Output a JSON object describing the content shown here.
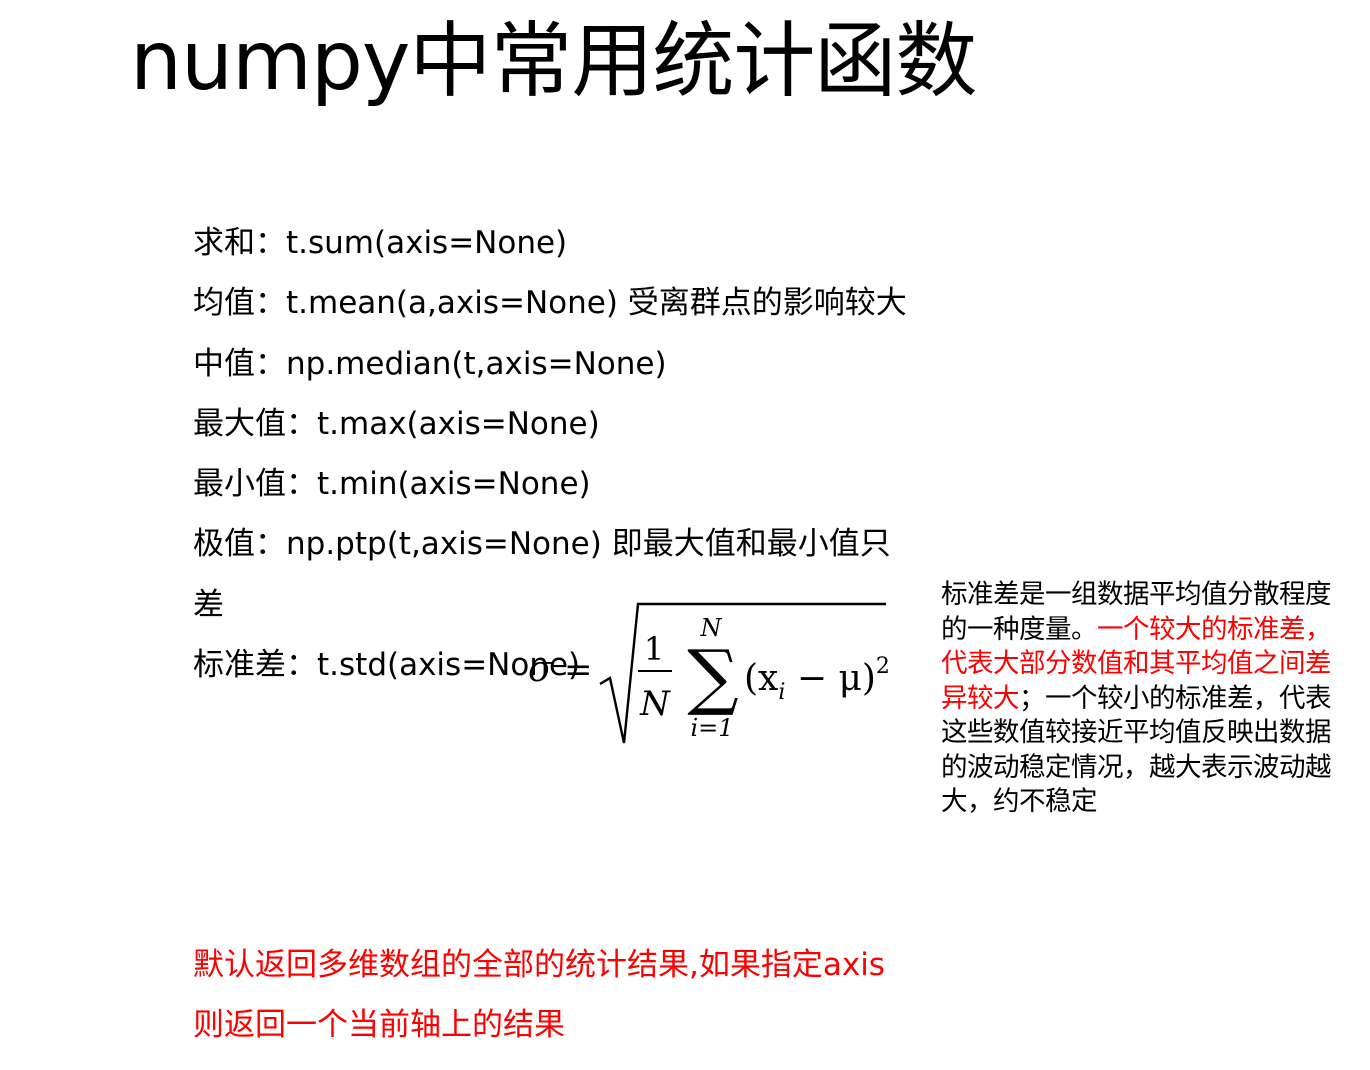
{
  "title": "numpy中常用统计函数",
  "functions": [
    {
      "text": "求和：t.sum(axis=None)"
    },
    {
      "text": "均值：t.mean(a,axis=None)  受离群点的影响较大"
    },
    {
      "text": "中值：np.median(t,axis=None)"
    },
    {
      "text": "最大值：t.max(axis=None)"
    },
    {
      "text": "最小值：t.min(axis=None)"
    },
    {
      "text": "极值：np.ptp(t,axis=None) 即最大值和最小值只"
    },
    {
      "text": "差"
    },
    {
      "text": "标准差：t.std(axis=None)"
    }
  ],
  "formula": {
    "sigma": "σ",
    "equals": "=",
    "numerator": "1",
    "denominator": "N",
    "sum_symbol": "∑",
    "upper_limit": "N",
    "lower_limit": "i=1",
    "term": "(x",
    "subscript": "i",
    "term_rest": " − μ)",
    "exponent": "2"
  },
  "note": {
    "part1": "标准差是一组数据平均值分散程度的一种度量。",
    "part2_red": "一个较大的标准差，代表大部分数值和其平均值之间差异较大",
    "part3": "；一个较小的标准差，代表这些数值较接近平均值反映出数据的波动稳定情况，越大表示波动越大，约不稳定"
  },
  "footer": {
    "line1": "默认返回多维数组的全部的统计结果,如果指定axis",
    "line2": "则返回一个当前轴上的结果"
  },
  "colors": {
    "text": "#000000",
    "highlight": "#ff0000",
    "background": "#ffffff"
  }
}
